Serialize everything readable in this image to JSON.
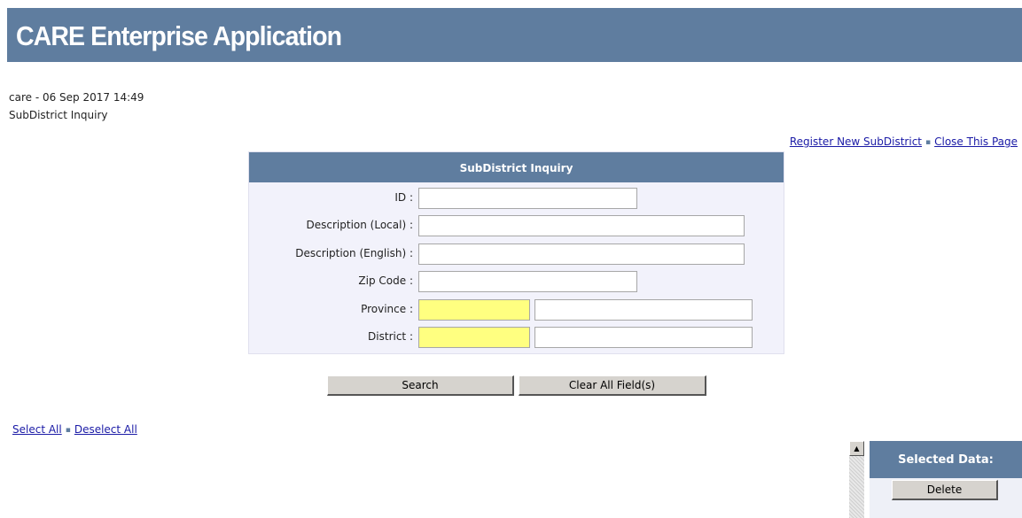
{
  "app": {
    "title": "CARE Enterprise Application"
  },
  "session": {
    "user_line": "care - 06 Sep 2017 14:49",
    "page_title": "SubDistrict Inquiry"
  },
  "top_links": {
    "register": "Register New SubDistrict",
    "close": "Close This Page",
    "separator": "▪"
  },
  "form": {
    "title": "SubDistrict Inquiry",
    "fields": {
      "id": {
        "label": "ID :",
        "value": ""
      },
      "desc_local": {
        "label": "Description (Local) :",
        "value": ""
      },
      "desc_english": {
        "label": "Description (English) :",
        "value": ""
      },
      "zip": {
        "label": "Zip Code :",
        "value": ""
      },
      "province": {
        "label": "Province :",
        "code": "",
        "name": ""
      },
      "district": {
        "label": "District :",
        "code": "",
        "name": ""
      }
    },
    "required_color": "#ffff80"
  },
  "buttons": {
    "search": "Search",
    "clear": "Clear All Field(s)"
  },
  "selection_links": {
    "select_all": "Select All",
    "deselect_all": "Deselect All",
    "separator": "▪"
  },
  "selected_panel": {
    "title": "Selected Data:",
    "delete": "Delete",
    "scroll_up_icon": "▲"
  },
  "colors": {
    "header": "#5f7d9f",
    "panel_bg": "#f2f2fb",
    "link": "#1a1aa6"
  }
}
